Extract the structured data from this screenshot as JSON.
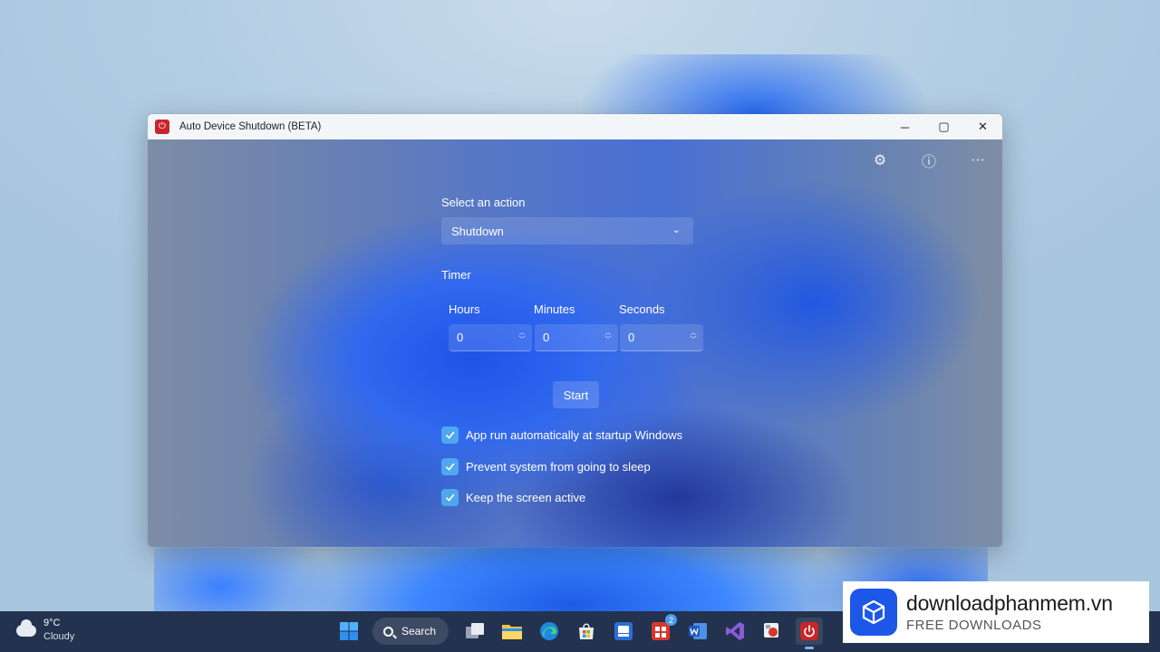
{
  "window": {
    "title": "Auto Device Shutdown (BETA)",
    "controls": {
      "minimize": "─",
      "maximize": "▢",
      "close": "✕"
    }
  },
  "toolbar": {
    "settings_icon": "⚙",
    "info_icon": "ⓘ",
    "more_icon": "···"
  },
  "form": {
    "action_label": "Select an action",
    "action_value": "Shutdown",
    "timer_label": "Timer",
    "hours_label": "Hours",
    "minutes_label": "Minutes",
    "seconds_label": "Seconds",
    "hours_value": "0",
    "minutes_value": "0",
    "seconds_value": "0",
    "start_label": "Start",
    "options": [
      {
        "label": "App run automatically at startup Windows",
        "checked": true
      },
      {
        "label": "Prevent system from going to sleep",
        "checked": true
      },
      {
        "label": "Keep the screen active",
        "checked": true
      }
    ]
  },
  "taskbar": {
    "weather_temp": "9°C",
    "weather_desc": "Cloudy",
    "search_label": "Search",
    "store_badge": "2",
    "icons": [
      "windows-start-icon",
      "task-view-icon",
      "file-explorer-icon",
      "edge-icon",
      "store-icon",
      "bus-app-icon",
      "office-icon",
      "word-icon",
      "visual-studio-icon",
      "snipping-icon",
      "auto-shutdown-icon"
    ]
  },
  "watermark": {
    "title": "downloadphanmem.vn",
    "subtitle": "FREE DOWNLOADS"
  },
  "colors": {
    "app_icon": "#c4262b",
    "checkbox": "#4fa7f0",
    "taskbar": "#23324e",
    "watermark_logo": "#1d57e8"
  }
}
